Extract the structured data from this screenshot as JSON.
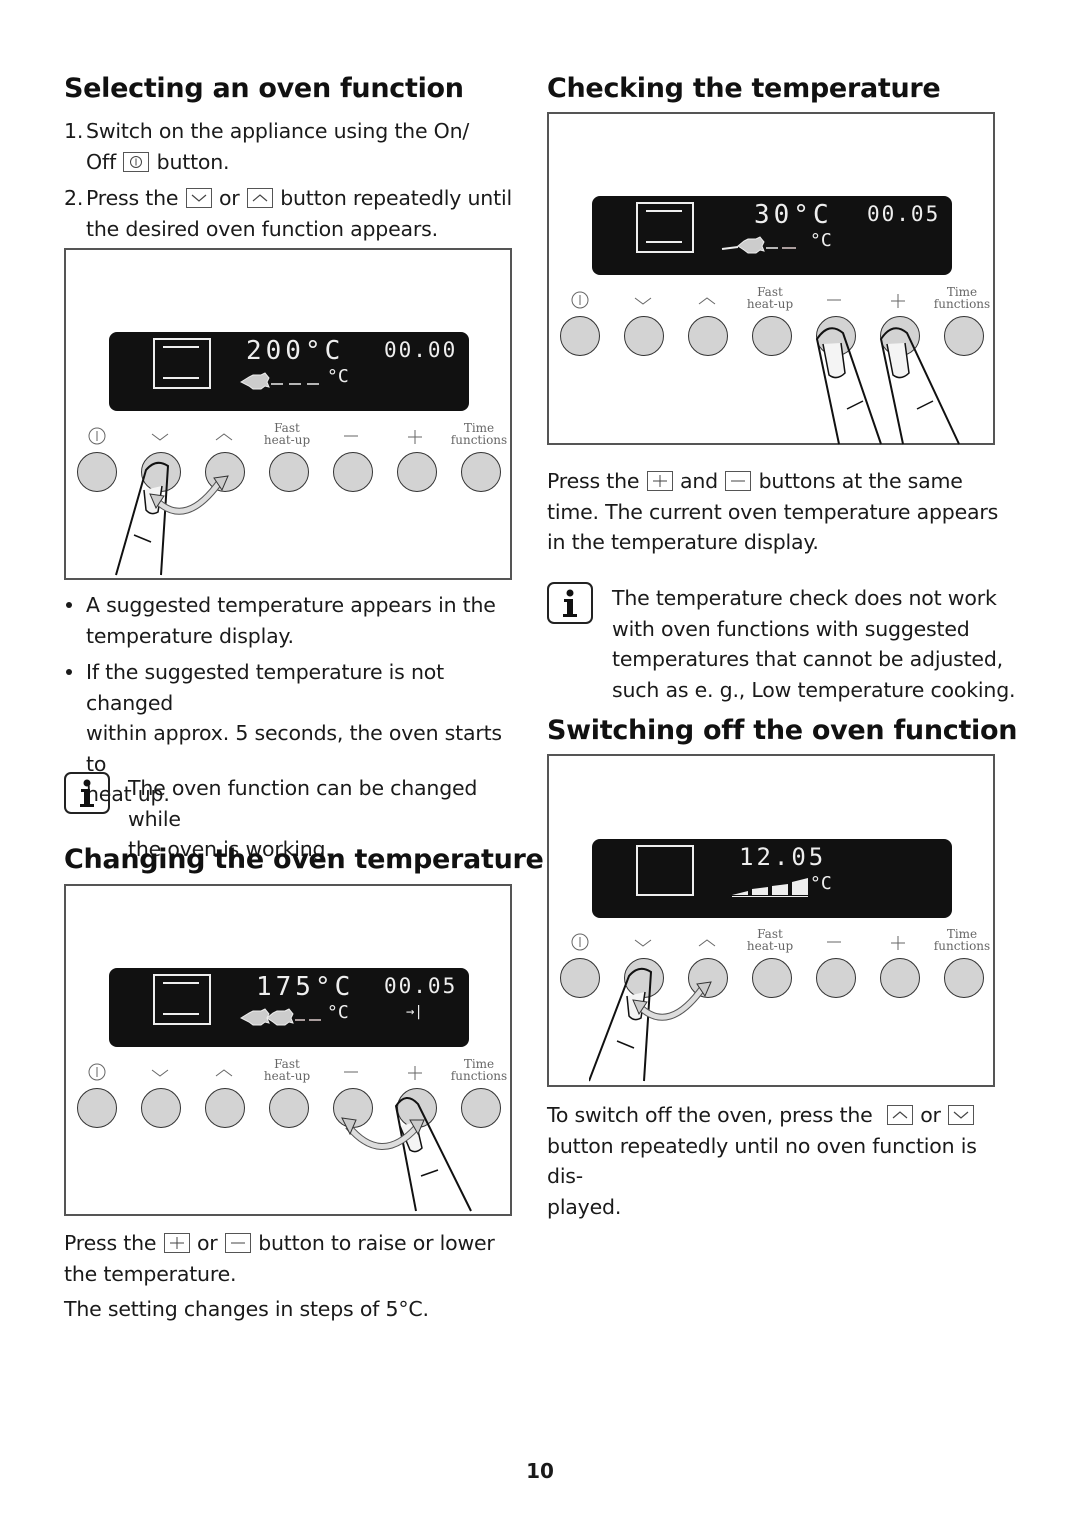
{
  "page_number": "10",
  "left": {
    "section1": {
      "title": "Selecting an oven function",
      "steps": [
        {
          "num": "1.",
          "line1": "Switch on the appliance using the On/",
          "line2_pre": "Off",
          "line2_post": "button.",
          "key_icon": "power-icon"
        },
        {
          "num": "2.",
          "pre": "Press the",
          "mid": "or",
          "post": "button repeatedly until",
          "line2": "the desired oven function appears.",
          "key_icons": [
            "chevron-down-icon",
            "chevron-up-icon"
          ]
        }
      ],
      "figure": {
        "display": {
          "temperature": "200°C",
          "time": "00.00",
          "unit": "°C"
        },
        "pressed_buttons": [
          "down",
          "up"
        ]
      },
      "bullets": [
        {
          "line1": "A suggested temperature appears in the",
          "line2": "temperature display."
        },
        {
          "line1": "If the suggested temperature is not changed",
          "line2": "within approx. 5 seconds, the oven starts to",
          "line3": "heat up."
        }
      ],
      "info": {
        "line1": "The oven function can be changed while",
        "line2": "the oven is working."
      }
    },
    "section2": {
      "title": "Changing the oven temperature",
      "figure": {
        "display": {
          "temperature": "175°C",
          "time": "00.05",
          "unit": "°C",
          "end_icon": "→|"
        },
        "pressed_buttons": [
          "minus",
          "plus"
        ]
      },
      "text1_pre": "Press the",
      "text1_mid": "or",
      "text1_post": "button to raise or lower",
      "text1_line2": "the temperature.",
      "text2": "The setting changes in steps of 5°C."
    }
  },
  "right": {
    "section3": {
      "title": "Checking the temperature",
      "figure": {
        "display": {
          "temperature": "30°C",
          "time": "00.05",
          "unit": "°C"
        },
        "pressed_buttons": [
          "minus",
          "plus"
        ]
      },
      "text_pre": "Press the",
      "text_mid": "and",
      "text_post": "buttons at the same",
      "text_line2": "time. The current oven temperature appears",
      "text_line3": "in the temperature display.",
      "info": {
        "line1": "The temperature check does not work",
        "line2": "with oven functions with suggested",
        "line3": "temperatures that cannot be adjusted,",
        "line4": "such as e. g., Low temperature cooking."
      }
    },
    "section4": {
      "title": "Switching off the oven function",
      "figure": {
        "display": {
          "clock": "12.05",
          "unit": "°C",
          "heat_bars": 4
        },
        "pressed_buttons": [
          "down",
          "up"
        ]
      },
      "text_pre": "To switch off the oven, press the",
      "text_mid": "or",
      "text_line2": "button repeatedly until no oven function is dis-",
      "text_line3": "played."
    }
  },
  "panel": {
    "labels": [
      "",
      "",
      "",
      "Fast heat-up",
      "",
      "",
      "Time functions"
    ],
    "label_fast_1": "Fast",
    "label_fast_2": "heat-up",
    "label_time_1": "Time",
    "label_time_2": "functions",
    "symbols": [
      "power",
      "down",
      "up",
      "fast-heat-up",
      "minus",
      "plus",
      "time-functions"
    ]
  }
}
